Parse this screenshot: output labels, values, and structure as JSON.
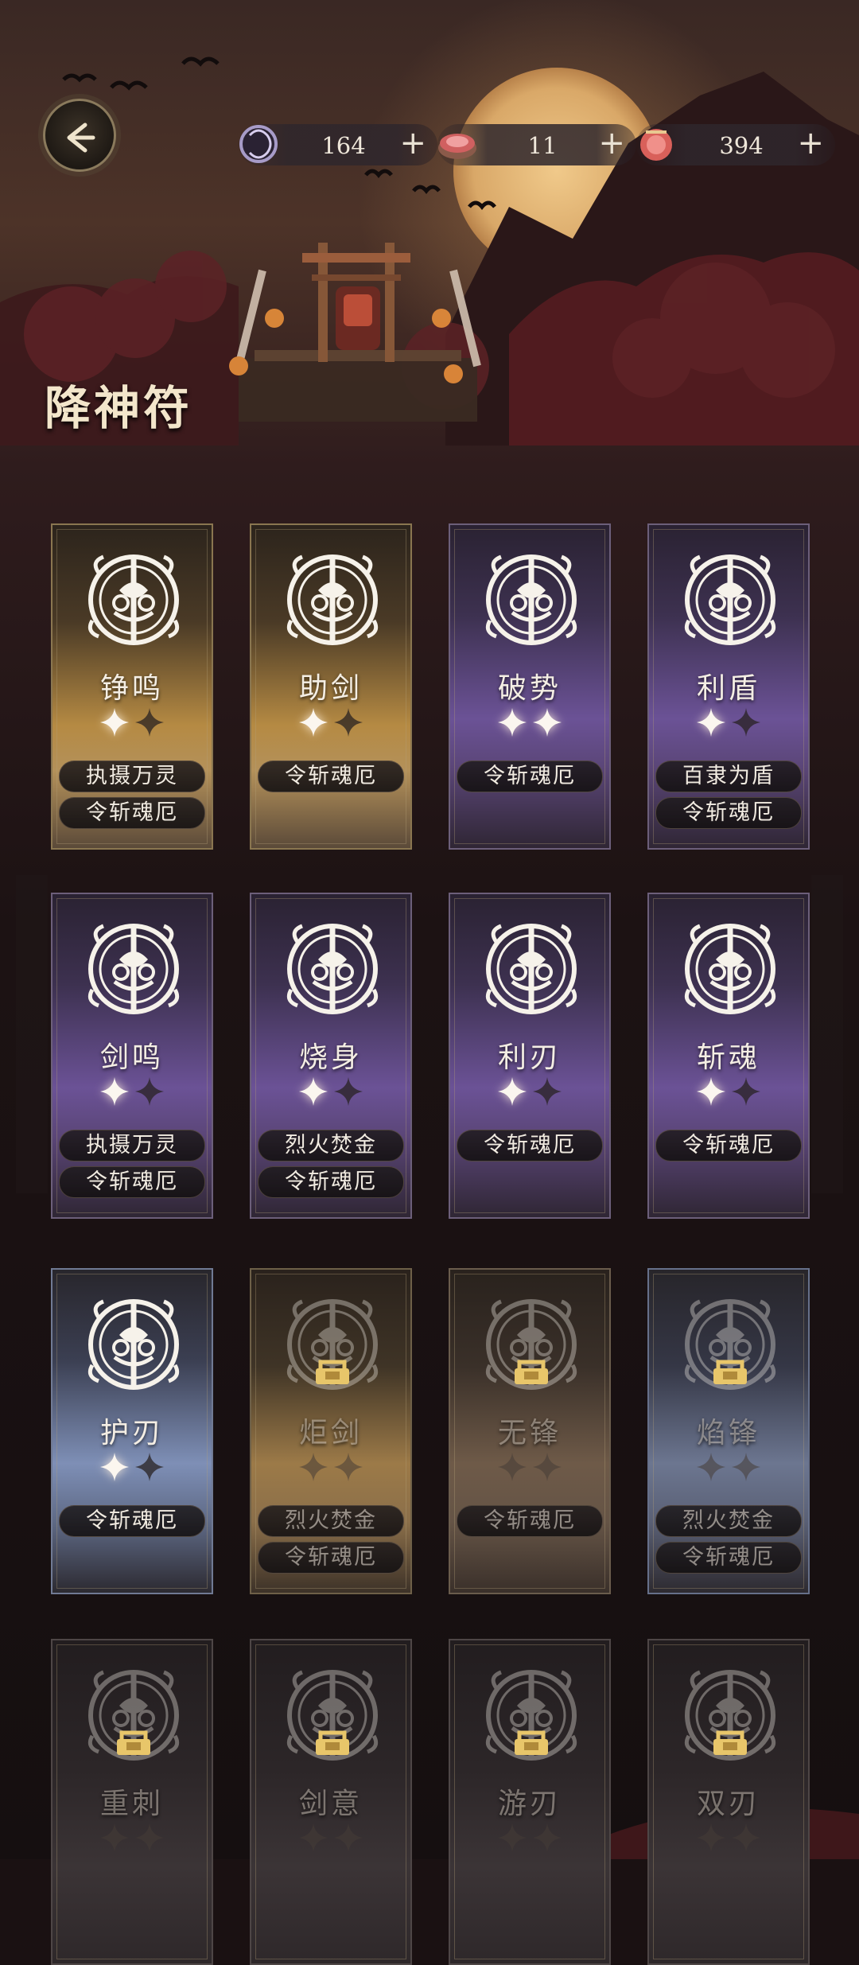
{
  "colors": {
    "gold": "#d9b46a",
    "purple": "#6b5296",
    "blue": "#7e8fb6",
    "text": "#f4eee4"
  },
  "header": {
    "back_icon": "back-arrow-icon",
    "resources": [
      {
        "icon": "spirit-ring-icon",
        "value": "164",
        "plus": "+"
      },
      {
        "icon": "incense-box-icon",
        "value": "11",
        "plus": "+"
      },
      {
        "icon": "talisman-pouch-icon",
        "value": "394",
        "plus": "+"
      }
    ]
  },
  "page": {
    "title": "降神符"
  },
  "cards": [
    {
      "name": "铮鸣",
      "tags": [
        "执摄万灵",
        "令斩魂厄"
      ],
      "stars_lit": 1,
      "stars_total": 2,
      "locked": false,
      "tier": "gold"
    },
    {
      "name": "助剑",
      "tags": [
        "令斩魂厄"
      ],
      "stars_lit": 1,
      "stars_total": 2,
      "locked": false,
      "tier": "gold"
    },
    {
      "name": "破势",
      "tags": [
        "令斩魂厄"
      ],
      "stars_lit": 2,
      "stars_total": 2,
      "locked": false,
      "tier": "purple"
    },
    {
      "name": "利盾",
      "tags": [
        "百隶为盾",
        "令斩魂厄"
      ],
      "stars_lit": 1,
      "stars_total": 2,
      "locked": false,
      "tier": "purple"
    },
    {
      "name": "剑鸣",
      "tags": [
        "执摄万灵",
        "令斩魂厄"
      ],
      "stars_lit": 1,
      "stars_total": 2,
      "locked": false,
      "tier": "purple"
    },
    {
      "name": "烧身",
      "tags": [
        "烈火焚金",
        "令斩魂厄"
      ],
      "stars_lit": 1,
      "stars_total": 2,
      "locked": false,
      "tier": "purple"
    },
    {
      "name": "利刃",
      "tags": [
        "令斩魂厄"
      ],
      "stars_lit": 1,
      "stars_total": 2,
      "locked": false,
      "tier": "purple"
    },
    {
      "name": "斩魂",
      "tags": [
        "令斩魂厄"
      ],
      "stars_lit": 1,
      "stars_total": 2,
      "locked": false,
      "tier": "purple"
    },
    {
      "name": "护刃",
      "tags": [
        "令斩魂厄"
      ],
      "stars_lit": 1,
      "stars_total": 2,
      "locked": false,
      "tier": "blue"
    },
    {
      "name": "炬剑",
      "tags": [
        "烈火焚金",
        "令斩魂厄"
      ],
      "stars_lit": 0,
      "stars_total": 2,
      "locked": true,
      "tier": "lgold"
    },
    {
      "name": "无锋",
      "tags": [
        "令斩魂厄"
      ],
      "stars_lit": 0,
      "stars_total": 2,
      "locked": true,
      "tier": "lbrown"
    },
    {
      "name": "焰锋",
      "tags": [
        "烈火焚金",
        "令斩魂厄"
      ],
      "stars_lit": 0,
      "stars_total": 2,
      "locked": true,
      "tier": "lblue"
    },
    {
      "name": "重刺",
      "tags": [],
      "stars_lit": 0,
      "stars_total": 2,
      "locked": true,
      "tier": "dark"
    },
    {
      "name": "剑意",
      "tags": [],
      "stars_lit": 0,
      "stars_total": 2,
      "locked": true,
      "tier": "dark"
    },
    {
      "name": "游刃",
      "tags": [],
      "stars_lit": 0,
      "stars_total": 2,
      "locked": true,
      "tier": "dark"
    },
    {
      "name": "双刃",
      "tags": [],
      "stars_lit": 0,
      "stars_total": 2,
      "locked": true,
      "tier": "dark"
    }
  ]
}
